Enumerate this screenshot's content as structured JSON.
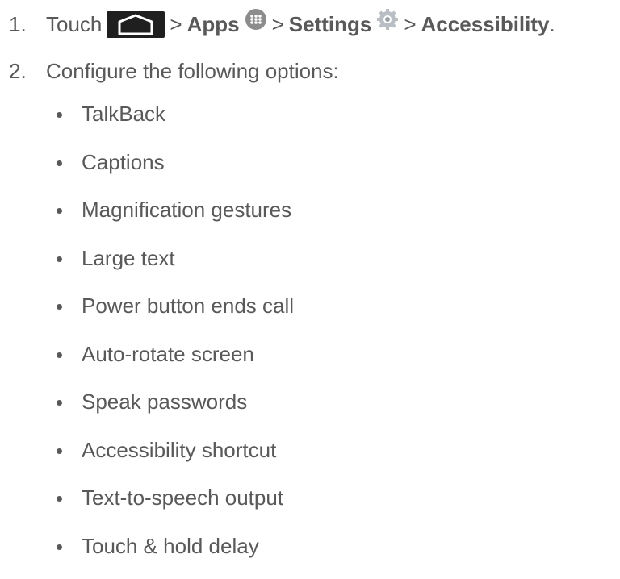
{
  "steps": [
    {
      "number": "1.",
      "text_before": "Touch",
      "separator": ">",
      "apps_label": "Apps",
      "settings_label": "Settings",
      "accessibility_label": "Accessibility",
      "end_punct": "."
    },
    {
      "number": "2.",
      "text": "Configure the following options:"
    }
  ],
  "icons": {
    "home": "home-button-icon",
    "apps": "apps-launcher-icon",
    "settings": "settings-gear-icon"
  },
  "options": [
    "TalkBack",
    "Captions",
    "Magnification gestures",
    "Large text",
    "Power button ends call",
    "Auto-rotate screen",
    "Speak passwords",
    "Accessibility shortcut",
    "Text-to-speech output",
    "Touch & hold delay"
  ]
}
